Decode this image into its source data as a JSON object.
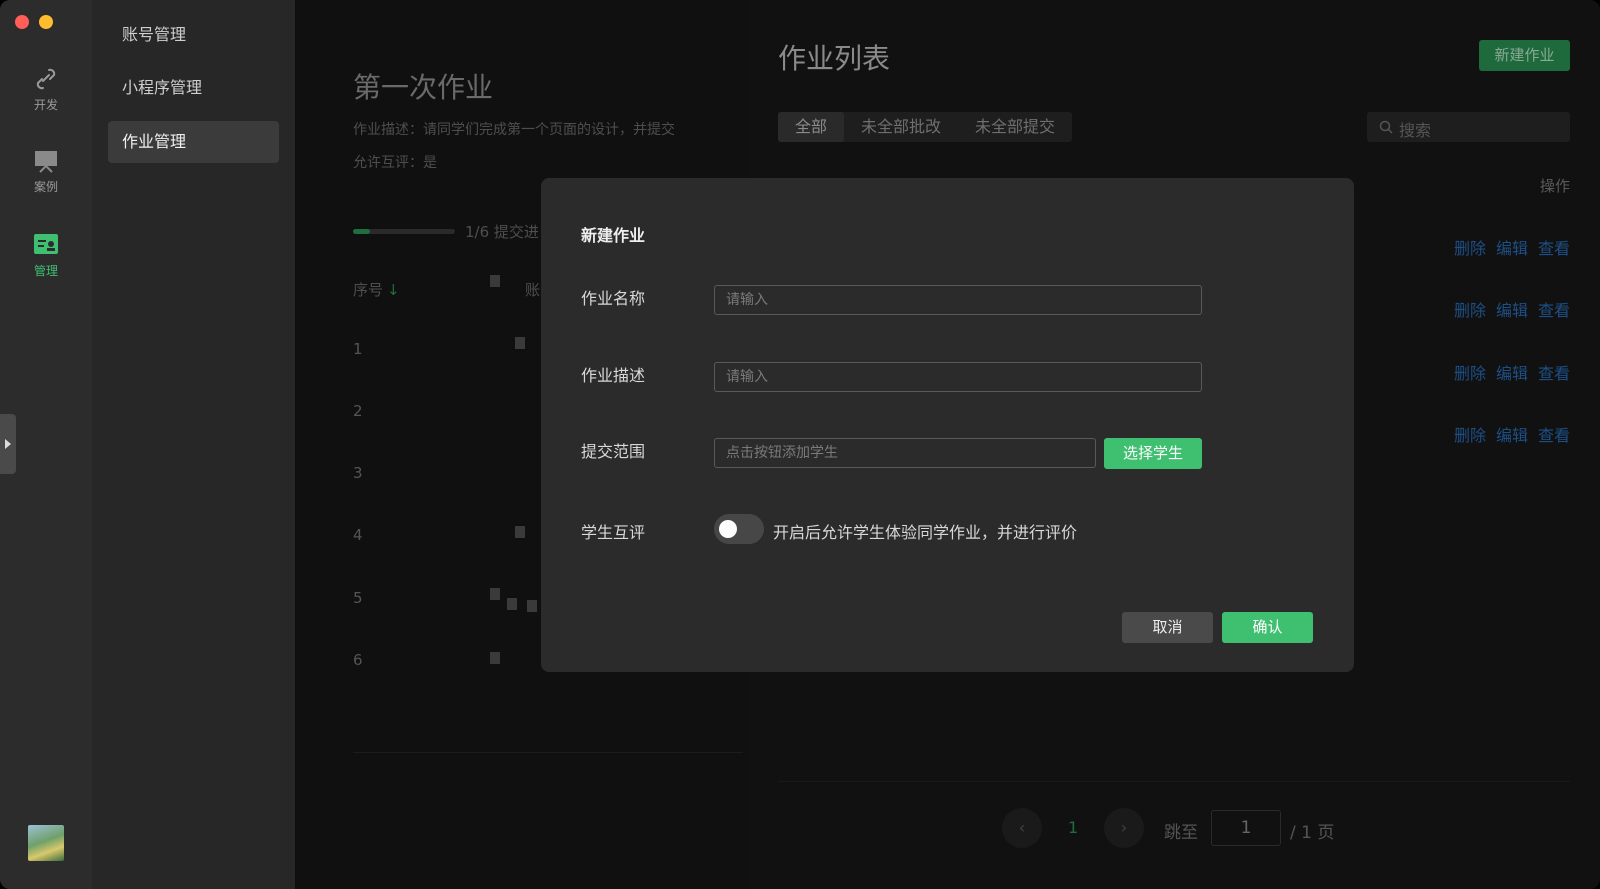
{
  "rail": {
    "items": [
      {
        "label": "开发",
        "icon": "link-icon"
      },
      {
        "label": "案例",
        "icon": "monitor-icon"
      },
      {
        "label": "管理",
        "icon": "manage-icon"
      }
    ]
  },
  "menu": {
    "items": [
      {
        "label": "账号管理"
      },
      {
        "label": "小程序管理"
      },
      {
        "label": "作业管理"
      }
    ]
  },
  "detail": {
    "title": "第一次作业",
    "description": "作业描述：请同学们完成第一个页面的设计，并提交",
    "peer_review": "允许互评：是",
    "progress_text": "1/6 提交进",
    "progress_fraction": 0.167,
    "col_index": "序号",
    "col_index_arrow": "↓",
    "col_account": "账",
    "rows": [
      "1",
      "2",
      "3",
      "4",
      "5",
      "6"
    ]
  },
  "list": {
    "title": "作业列表",
    "new_button": "新建作业",
    "tabs": [
      "全部",
      "未全部批改",
      "未全部提交"
    ],
    "search_placeholder": "搜索",
    "col_actions": "操作",
    "actions": {
      "delete": "删除",
      "edit": "编辑",
      "view": "查看"
    },
    "pager": {
      "prev": "‹",
      "page": "1",
      "next": "›",
      "jump_label": "跳至",
      "jump_value": "1",
      "total": "/ 1 页"
    }
  },
  "modal": {
    "title": "新建作业",
    "name_label": "作业名称",
    "name_placeholder": "请输入",
    "desc_label": "作业描述",
    "desc_placeholder": "请输入",
    "scope_label": "提交范围",
    "scope_placeholder": "点击按钮添加学生",
    "select_button": "选择学生",
    "peer_label": "学生互评",
    "peer_toggle_text": "开启后允许学生体验同学作业，并进行评价",
    "cancel": "取消",
    "confirm": "确认"
  },
  "colors": {
    "accent": "#3fbf70",
    "link": "#1d4f86"
  }
}
